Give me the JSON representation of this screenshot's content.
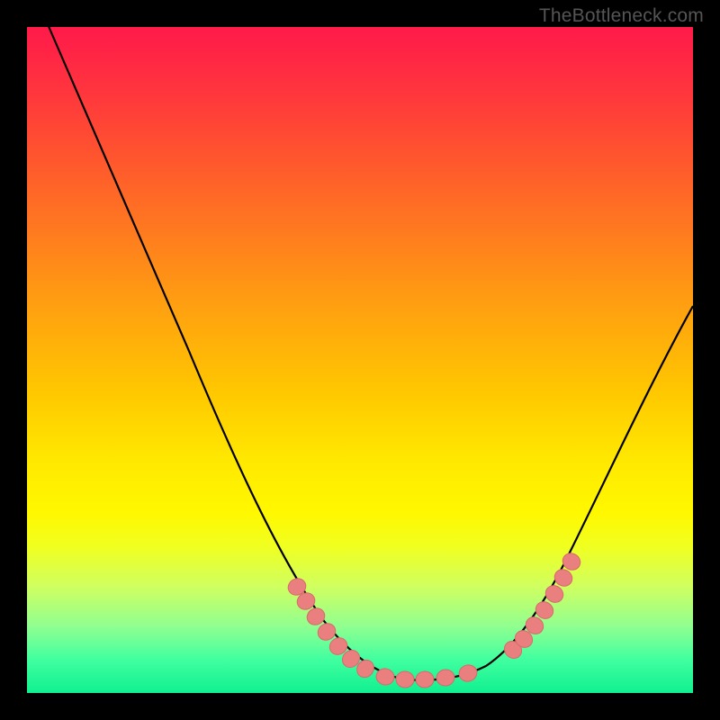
{
  "watermark": "TheBottleneck.com",
  "chart_data": {
    "type": "line",
    "title": "",
    "xlabel": "",
    "ylabel": "",
    "xlim": [
      0,
      100
    ],
    "ylim": [
      0,
      100
    ],
    "series": [
      {
        "name": "bottleneck-curve",
        "x": [
          2,
          6,
          10,
          14,
          18,
          22,
          26,
          30,
          34,
          38,
          42,
          46,
          50,
          54,
          58,
          62,
          66,
          70,
          74,
          78,
          82,
          86,
          90,
          94,
          98
        ],
        "values": [
          100,
          92,
          84,
          76,
          68,
          60,
          52,
          44,
          36,
          28,
          20,
          12,
          5,
          1,
          0,
          0,
          1,
          5,
          12,
          20,
          28,
          36,
          44,
          52,
          60
        ]
      }
    ],
    "markers": {
      "name": "highlight-points",
      "x": [
        37,
        39,
        41,
        43,
        45,
        48,
        52,
        56,
        60,
        62,
        65,
        67,
        69,
        71,
        73
      ],
      "values": [
        22,
        18,
        14,
        10,
        6,
        2,
        0.5,
        0.5,
        1,
        2,
        5,
        8,
        12,
        16,
        20
      ],
      "color": "#e88080"
    },
    "colors": {
      "curve": "#000000",
      "marker_fill": "#e97f7f",
      "marker_stroke": "#d86a6a",
      "gradient_top": "#ff1a4a",
      "gradient_bottom": "#10f090"
    }
  }
}
